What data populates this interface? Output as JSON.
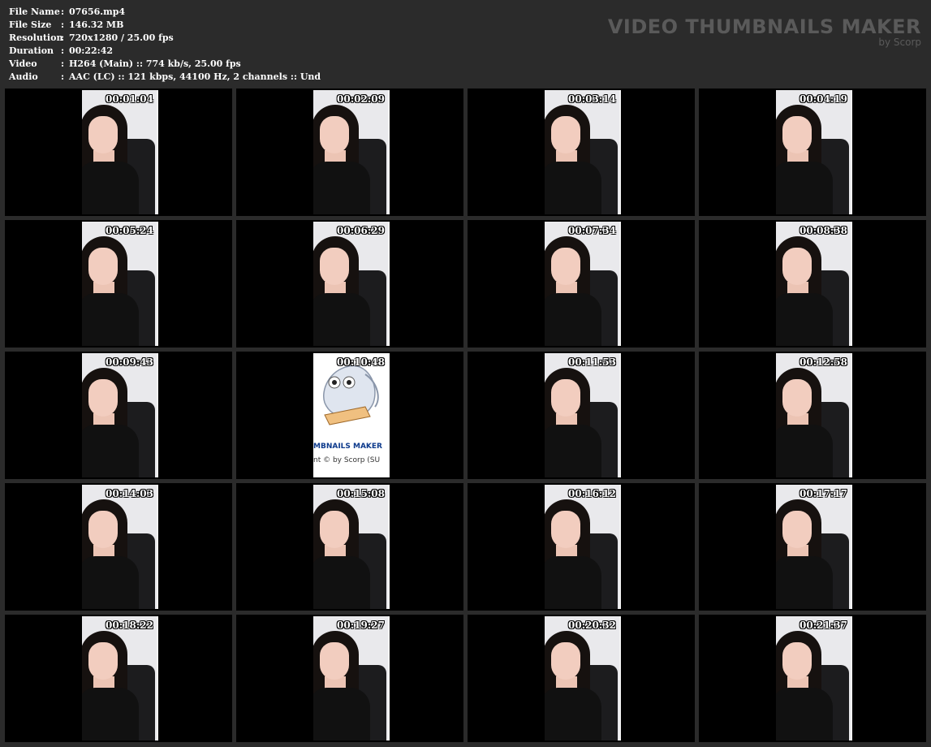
{
  "info": [
    {
      "label": "File Name",
      "value": "07656.mp4"
    },
    {
      "label": "File Size",
      "value": "146.32 MB"
    },
    {
      "label": "Resolution",
      "value": "720x1280 / 25.00 fps"
    },
    {
      "label": "Duration",
      "value": "00:22:42"
    },
    {
      "label": "Video",
      "value": "H264 (Main) :: 774 kb/s, 25.00 fps"
    },
    {
      "label": "Audio",
      "value": "AAC (LC) :: 121 kbps, 44100 Hz, 2 channels :: Und"
    }
  ],
  "separator": ":",
  "watermark": {
    "title": "VIDEO THUMBNAILS MAKER",
    "subtitle": "by Scorp"
  },
  "thumbnails": [
    {
      "time": "00:01:04"
    },
    {
      "time": "00:02:09"
    },
    {
      "time": "00:03:14"
    },
    {
      "time": "00:04:19"
    },
    {
      "time": "00:05:24"
    },
    {
      "time": "00:06:29"
    },
    {
      "time": "00:07:34"
    },
    {
      "time": "00:08:38"
    },
    {
      "time": "00:09:43"
    },
    {
      "time": "00:10:48"
    },
    {
      "time": "00:11:53"
    },
    {
      "time": "00:12:58"
    },
    {
      "time": "00:14:03"
    },
    {
      "time": "00:15:08"
    },
    {
      "time": "00:16:12"
    },
    {
      "time": "00:17:17"
    },
    {
      "time": "00:18:22"
    },
    {
      "time": "00:19:27"
    },
    {
      "time": "00:20:32"
    },
    {
      "time": "00:21:37"
    }
  ],
  "owl_frame": {
    "line1": "MBNAILS MAKER",
    "line2": "nt © by Scorp (SU"
  },
  "colors": {
    "background": "#2b2b2b",
    "cell": "#000000",
    "watermark": "#5a5a5a"
  }
}
